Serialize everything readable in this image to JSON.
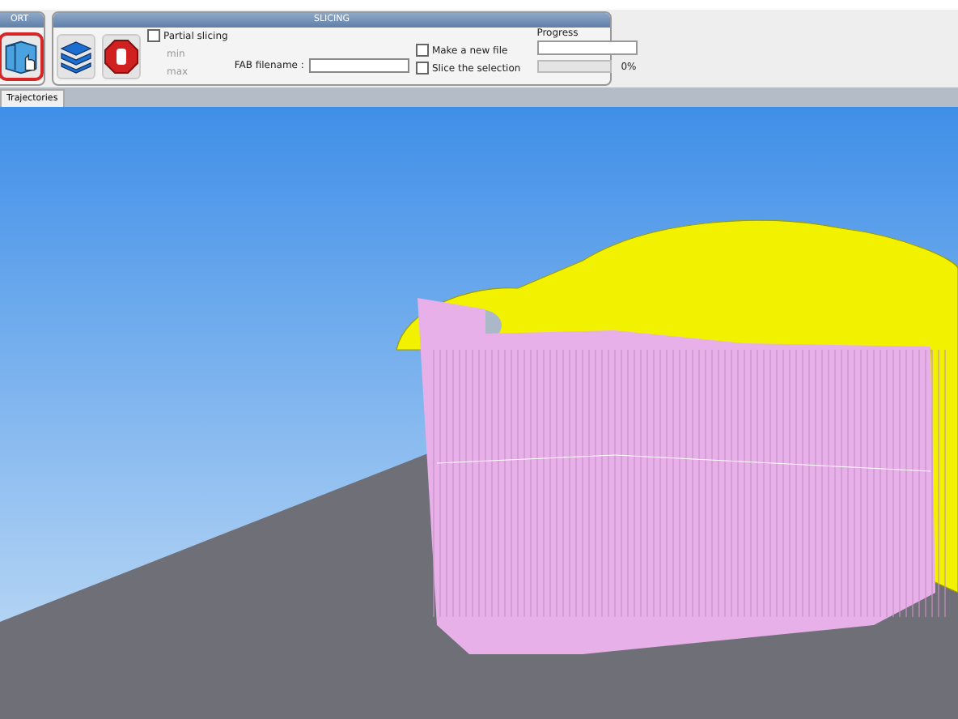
{
  "toolbar": {
    "export_group": {
      "title": "ORT",
      "highlighted": true
    },
    "slicing_group": {
      "title": "SLICING",
      "partial_slicing": {
        "label": "Partial slicing",
        "checked": false
      },
      "min_label": "min",
      "max_label": "max",
      "fab_filename": {
        "label": "FAB filename :"
      },
      "make_new_file": {
        "label": "Make a new file",
        "checked": false
      },
      "slice_selection": {
        "label": "Slice the selection",
        "checked": false
      },
      "progress": {
        "label": "Progress",
        "level": 0,
        "reading": "0%"
      }
    }
  },
  "tabs": [
    {
      "label": "Trajectories",
      "selected": true
    }
  ]
}
